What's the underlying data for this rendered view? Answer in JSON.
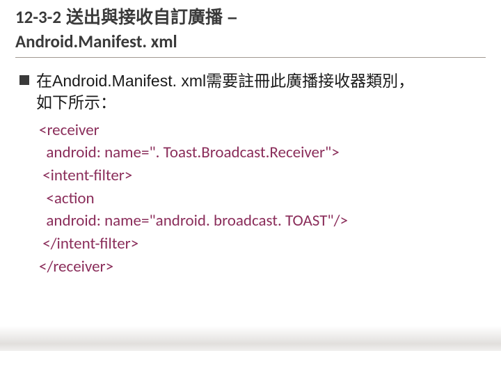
{
  "title": {
    "section_num": "12-3-2",
    "line1_text": "送出與接收自訂廣播 –",
    "line2": "Android.Manifest. xml"
  },
  "body": {
    "bullet_text_a": "在Android.Manifest. xml需要註冊此廣播接收器類別，",
    "bullet_text_b": "如下所示："
  },
  "code": {
    "l1": "<receiver",
    "l2": "  android: name=\". Toast.Broadcast.Receiver\">",
    "l3": " <intent-filter>",
    "l4": "  <action",
    "l5": "  android: name=\"android. broadcast. TOAST\"/>",
    "l6": " </intent-filter>",
    "l7": "</receiver>"
  },
  "colors": {
    "code": "#8a2d5a"
  }
}
